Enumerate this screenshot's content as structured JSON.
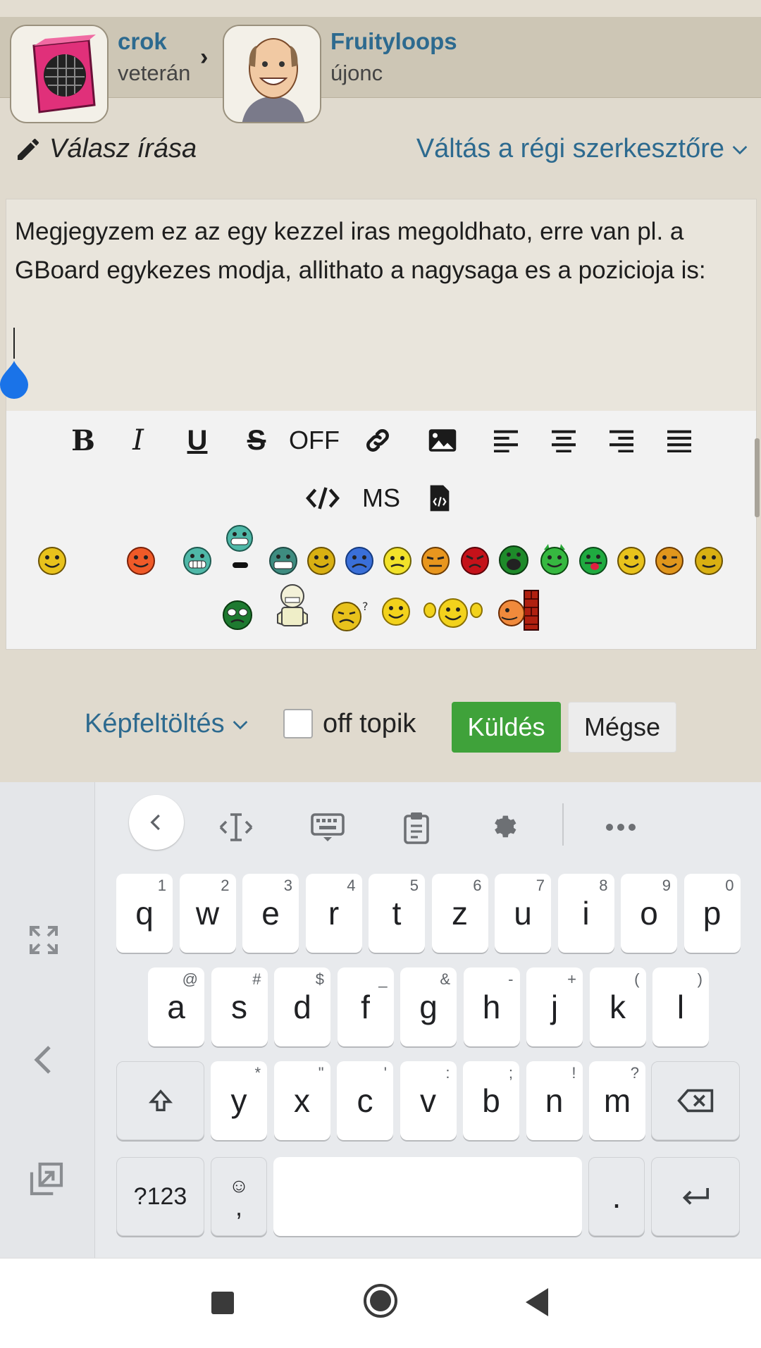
{
  "header": {
    "user1": {
      "name": "crok",
      "rank": "veterán"
    },
    "user2": {
      "name": "Fruityloops",
      "rank": "újonc"
    }
  },
  "editor_header": {
    "reply_label": "Válasz írása",
    "switch_label": "Váltás a régi szerkesztőre"
  },
  "editor": {
    "text": "Megjegyzem ez az egy kezzel iras megoldhato, erre van pl. a GBoard egykezes modja, allithato a nagysaga es a pozicioja is:"
  },
  "toolbar": {
    "off_label": "OFF",
    "ms_label": "MS",
    "icons": [
      "bold-icon",
      "italic-icon",
      "underline-icon",
      "strikethrough-icon",
      "off-topic-text",
      "link-icon",
      "image-icon",
      "align-left-icon",
      "align-center-icon",
      "align-right-icon",
      "align-justify-icon",
      "code-icon",
      "ms-text",
      "file-code-icon"
    ]
  },
  "bottom_bar": {
    "upload_label": "Képfeltöltés",
    "offtopic_label": "off topik",
    "send_label": "Küldés",
    "cancel_label": "Mégse"
  },
  "keyboard": {
    "row1": [
      {
        "k": "q",
        "h": "1"
      },
      {
        "k": "w",
        "h": "2"
      },
      {
        "k": "e",
        "h": "3"
      },
      {
        "k": "r",
        "h": "4"
      },
      {
        "k": "t",
        "h": "5"
      },
      {
        "k": "z",
        "h": "6"
      },
      {
        "k": "u",
        "h": "7"
      },
      {
        "k": "i",
        "h": "8"
      },
      {
        "k": "o",
        "h": "9"
      },
      {
        "k": "p",
        "h": "0"
      }
    ],
    "row2": [
      {
        "k": "a",
        "h": "@"
      },
      {
        "k": "s",
        "h": "#"
      },
      {
        "k": "d",
        "h": "$"
      },
      {
        "k": "f",
        "h": "_"
      },
      {
        "k": "g",
        "h": "&"
      },
      {
        "k": "h",
        "h": "-"
      },
      {
        "k": "j",
        "h": "+"
      },
      {
        "k": "k",
        "h": "("
      },
      {
        "k": "l",
        "h": ")"
      }
    ],
    "row3": [
      {
        "k": "y",
        "h": "*"
      },
      {
        "k": "x",
        "h": "\""
      },
      {
        "k": "c",
        "h": "'"
      },
      {
        "k": "v",
        "h": ":"
      },
      {
        "k": "b",
        "h": ";"
      },
      {
        "k": "n",
        "h": "!"
      },
      {
        "k": "m",
        "h": "?"
      }
    ],
    "symbols_label": "?123",
    "comma_label": ",",
    "period_label": "."
  },
  "colors": {
    "link": "#2d6a8f",
    "send": "#3fa23a",
    "caret_handle": "#1a73e8"
  }
}
